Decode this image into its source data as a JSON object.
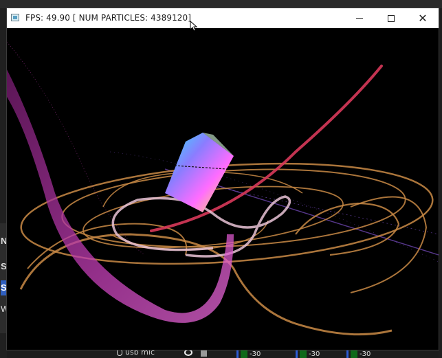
{
  "window": {
    "title": "FPS: 49.90 [ NUM PARTICLES: 4389120]",
    "icon": "app-window-icon",
    "controls": {
      "minimize": "minimize-icon",
      "maximize": "maximize-icon",
      "close": "close-icon"
    }
  },
  "scene": {
    "description_icon": "particle-simulation-viewport",
    "colors": {
      "orange_swirl": "#c98a45",
      "magenta_stream": "#c23fb6",
      "red_trail": "#d8385a",
      "pale_loop": "#e9c3d6",
      "violet_line": "#7a4fc6",
      "cube_gradient_a": "#34c8ff",
      "cube_gradient_b": "#f9ff3a",
      "cube_gradient_c": "#ff66ff"
    }
  },
  "background_ui": {
    "left_letters": [
      "N",
      "S",
      "S",
      "W"
    ],
    "bottom": {
      "device_label": "usb mic",
      "meters": [
        "-30",
        "-30",
        "-30"
      ]
    }
  }
}
